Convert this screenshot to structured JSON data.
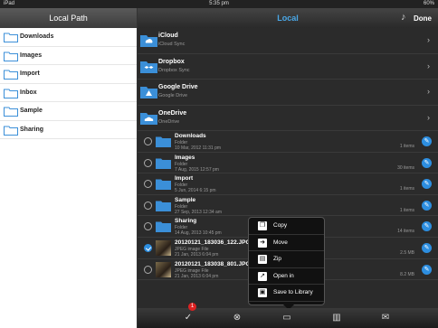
{
  "statusbar": {
    "device": "iPad",
    "time": "5:35 pm",
    "battery": "60%"
  },
  "left": {
    "title": "Local Path",
    "items": [
      {
        "label": "Downloads"
      },
      {
        "label": "Images"
      },
      {
        "label": "Import"
      },
      {
        "label": "Inbox"
      },
      {
        "label": "Sample"
      },
      {
        "label": "Sharing"
      }
    ]
  },
  "right": {
    "title": "Local",
    "done_label": "Done",
    "clouds": [
      {
        "name": "iCloud",
        "sub": "iCloud Sync"
      },
      {
        "name": "Dropbox",
        "sub": "Dropbox Sync"
      },
      {
        "name": "Google Drive",
        "sub": "Google Drive"
      },
      {
        "name": "OneDrive",
        "sub": "OneDrive"
      }
    ],
    "files": [
      {
        "name": "Downloads",
        "kind": "Folder",
        "date": "10 Mar, 2012 11:31 pm",
        "count": "1 items"
      },
      {
        "name": "Images",
        "kind": "Folder",
        "date": "7 Aug, 2015 12:57 pm",
        "count": "30 items"
      },
      {
        "name": "Import",
        "kind": "Folder",
        "date": "5 Jun, 2014 6:15 pm",
        "count": "1 items"
      },
      {
        "name": "Sample",
        "kind": "Folder",
        "date": "27 Sep, 2013 12:34 am",
        "count": "1 items"
      },
      {
        "name": "Sharing",
        "kind": "Folder",
        "date": "14 Aug, 2013 10:45 pm",
        "count": "14 items"
      },
      {
        "name": "20120121_183036_122.JPG",
        "kind": "JPEG image File",
        "date": "21 Jan, 2013 6:04 pm",
        "count": "2.5 MB"
      },
      {
        "name": "20120121_183038_801.JPG",
        "kind": "JPEG image File",
        "date": "21 Jan, 2013 6:04 pm",
        "count": "8.2 MB"
      }
    ]
  },
  "popup": {
    "items": [
      {
        "label": "Copy"
      },
      {
        "label": "Move"
      },
      {
        "label": "Zip"
      },
      {
        "label": "Open in"
      },
      {
        "label": "Save to Library"
      }
    ]
  },
  "toolbar": {
    "badge": "1"
  },
  "colors": {
    "accent": "#2d8ee0",
    "title_blue": "#4aa8e8",
    "folder": "#3b8fd8",
    "dark_bg": "#2b2b2b"
  }
}
